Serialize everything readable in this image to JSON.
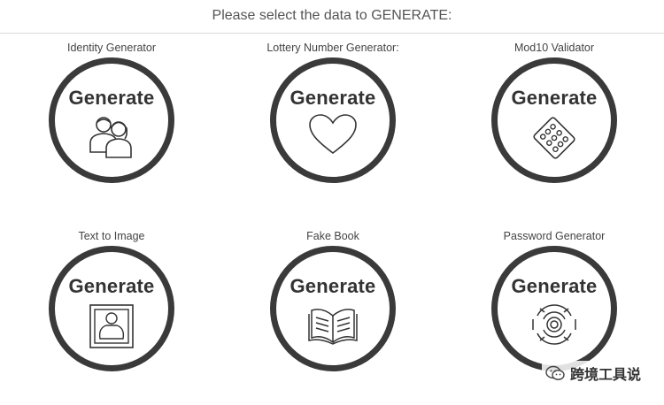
{
  "header": {
    "title": "Please select the data to GENERATE:"
  },
  "generators": [
    {
      "label": "Identity Generator",
      "button": "Generate",
      "icon": "people-icon"
    },
    {
      "label": "Lottery Number Generator:",
      "button": "Generate",
      "icon": "heart-icon"
    },
    {
      "label": "Mod10 Validator",
      "button": "Generate",
      "icon": "card-dots-icon"
    },
    {
      "label": "Text to Image",
      "button": "Generate",
      "icon": "framed-portrait-icon"
    },
    {
      "label": "Fake Book",
      "button": "Generate",
      "icon": "open-book-icon"
    },
    {
      "label": "Password Generator",
      "button": "Generate",
      "icon": "fingerprint-icon"
    }
  ],
  "watermark": {
    "text": "跨境工具说",
    "icon": "wechat-icon"
  }
}
